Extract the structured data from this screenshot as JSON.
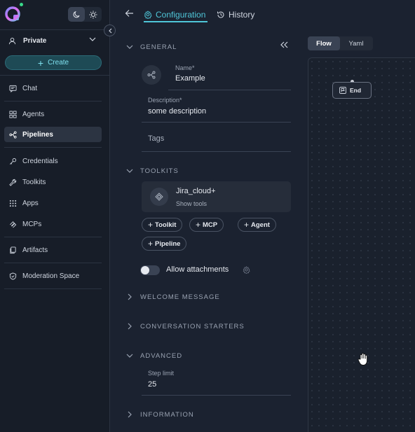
{
  "sidebar": {
    "scope_label": "Private",
    "create_label": "Create",
    "items": [
      {
        "label": "Chat",
        "icon": "chat-icon"
      },
      {
        "label": "Agents",
        "icon": "agents-icon"
      },
      {
        "label": "Pipelines",
        "icon": "pipelines-icon",
        "active": true
      },
      {
        "label": "Credentials",
        "icon": "key-icon"
      },
      {
        "label": "Toolkits",
        "icon": "wrench-icon"
      },
      {
        "label": "Apps",
        "icon": "apps-grid-icon"
      },
      {
        "label": "MCPs",
        "icon": "mcp-icon"
      },
      {
        "label": "Artifacts",
        "icon": "artifacts-icon"
      },
      {
        "label": "Moderation Space",
        "icon": "shield-icon"
      }
    ]
  },
  "topbar": {
    "tabs": [
      {
        "label": "Configuration",
        "active": true
      },
      {
        "label": "History",
        "active": false
      }
    ]
  },
  "general": {
    "title": "GENERAL",
    "name_label": "Name*",
    "name_value": "Example",
    "description_label": "Description*",
    "description_value": "some description",
    "tags_placeholder": "Tags"
  },
  "toolkits": {
    "title": "TOOLKITS",
    "card": {
      "name": "Jira_cloud+",
      "subtitle": "Show tools"
    },
    "add_buttons": [
      "Toolkit",
      "MCP",
      "Agent",
      "Pipeline"
    ],
    "attachments_label": "Allow attachments",
    "attachments_enabled": false
  },
  "sections": {
    "welcome_message": "WELCOME MESSAGE",
    "conversation_starters": "CONVERSATION STARTERS",
    "advanced": "ADVANCED",
    "information": "INFORMATION"
  },
  "advanced": {
    "step_limit_label": "Step limit",
    "step_limit_value": "25"
  },
  "canvas": {
    "view_tabs": [
      {
        "label": "Flow",
        "active": true
      },
      {
        "label": "Yaml",
        "active": false
      }
    ],
    "end_node_label": "End"
  },
  "colors": {
    "accent": "#4fc6d8",
    "sidebar_bg": "#171d28",
    "main_bg": "#1b2230",
    "status_dot": "#39d98a"
  }
}
